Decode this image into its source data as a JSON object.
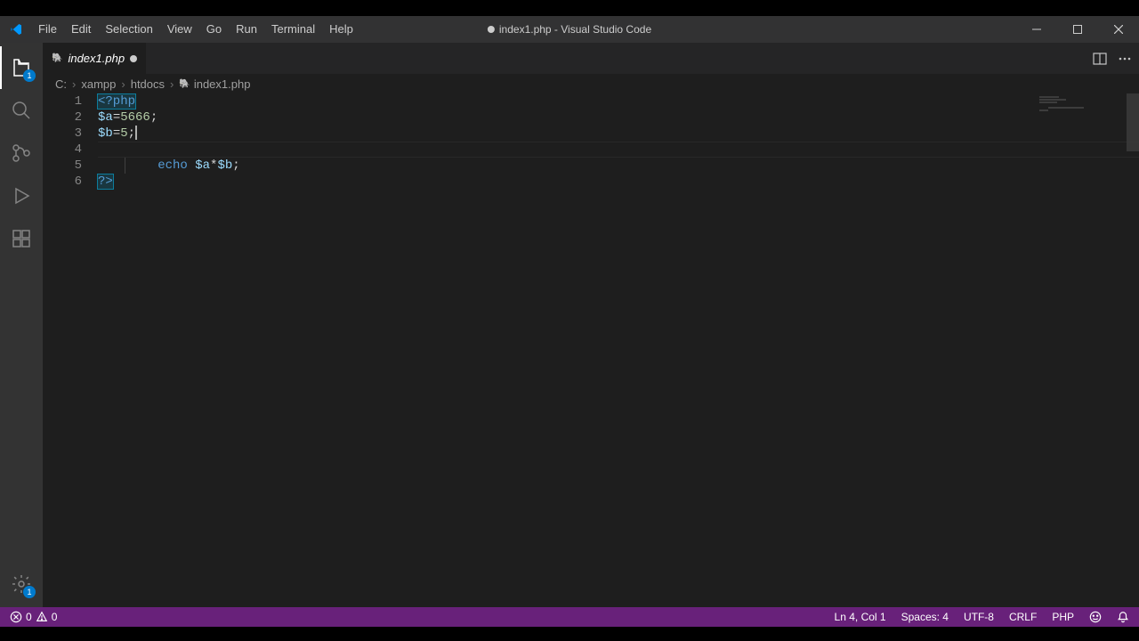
{
  "window": {
    "title_file": "index1.php",
    "title_app": "Visual Studio Code",
    "title_sep": " - ",
    "dirty": true
  },
  "menu": {
    "items": [
      "File",
      "Edit",
      "Selection",
      "View",
      "Go",
      "Run",
      "Terminal",
      "Help"
    ]
  },
  "activity": {
    "explorer_badge": "1",
    "settings_badge": "1"
  },
  "tab": {
    "file": "index1.php",
    "dirty": true
  },
  "breadcrumbs": {
    "parts": [
      "C:",
      "xampp",
      "htdocs",
      "index1.php"
    ]
  },
  "editor": {
    "line_numbers": [
      "1",
      "2",
      "3",
      "4",
      "5",
      "6"
    ],
    "lines": {
      "l1_open": "<?php",
      "l2_var": "$a",
      "l2_eq": "=",
      "l2_num": "5666",
      "l2_semi": ";",
      "l3_var": "$b",
      "l3_eq": "=",
      "l3_num": "5",
      "l3_semi": ";",
      "l5_echo": "echo",
      "l5_sp": " ",
      "l5_va": "$a",
      "l5_op": "*",
      "l5_vb": "$b",
      "l5_semi": ";",
      "l6_close": "?>"
    },
    "current_line_index": 3
  },
  "status": {
    "errors": "0",
    "warnings": "0",
    "cursor": "Ln 4, Col 1",
    "spaces": "Spaces: 4",
    "encoding": "UTF-8",
    "eol": "CRLF",
    "lang": "PHP"
  }
}
